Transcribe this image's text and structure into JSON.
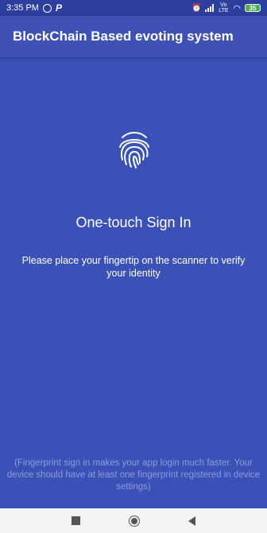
{
  "status_bar": {
    "time": "3:35 PM",
    "network_label": "Vo LTE",
    "battery": "35",
    "icons": [
      "whatsapp-icon",
      "p-app-icon",
      "alarm-off-icon",
      "signal-icon",
      "wifi-icon",
      "battery-icon"
    ],
    "battery_color": "#4caf50"
  },
  "app_bar": {
    "title": "BlockChain Based evoting system"
  },
  "content": {
    "icon": "fingerprint-icon",
    "title": "One-touch Sign In",
    "description": "Please place your fingertip on the scanner to verify your identity",
    "footer_note": "(Fingerprint sign in makes your app login much faster. Your device should have at least one fingerprint registered in device settings)"
  },
  "nav_bar": {
    "icons": [
      "recents-icon",
      "home-icon",
      "back-icon"
    ]
  },
  "colors": {
    "background": "#3a51b7",
    "app_bar": "#3f51b5",
    "status_bar": "#2c3e9f",
    "footer_text": "#8e9bd8",
    "nav_bar": "#f3f3f3"
  }
}
